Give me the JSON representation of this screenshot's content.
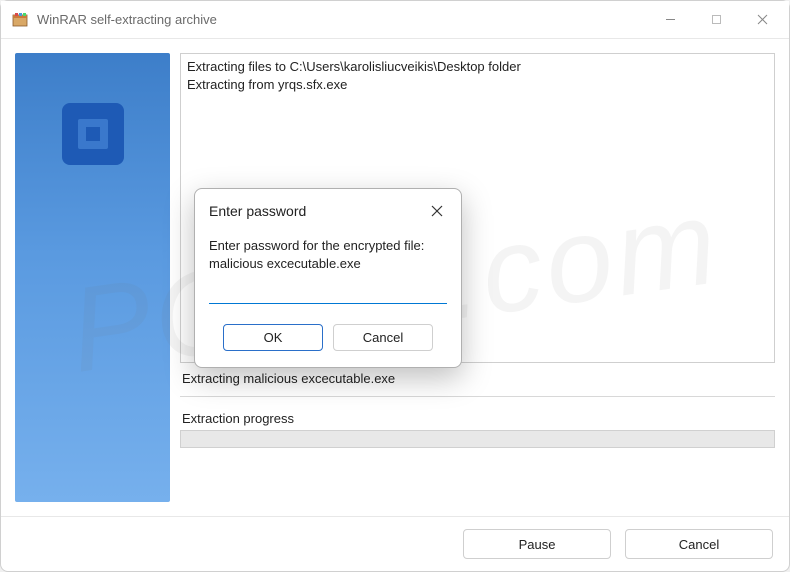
{
  "window": {
    "title": "WinRAR self-extracting archive"
  },
  "log": {
    "line1": "Extracting files to C:\\Users\\karolisliucveikis\\Desktop folder",
    "line2": "Extracting from yrqs.sfx.exe"
  },
  "status": {
    "current_file": "Extracting malicious excecutable.exe",
    "progress_label": "Extraction progress"
  },
  "footer": {
    "pause": "Pause",
    "cancel": "Cancel"
  },
  "dialog": {
    "title": "Enter password",
    "prompt_line1": "Enter password for the encrypted file:",
    "prompt_line2": "malicious excecutable.exe",
    "input_value": "",
    "ok": "OK",
    "cancel": "Cancel"
  },
  "watermark": "PCrisk.com"
}
